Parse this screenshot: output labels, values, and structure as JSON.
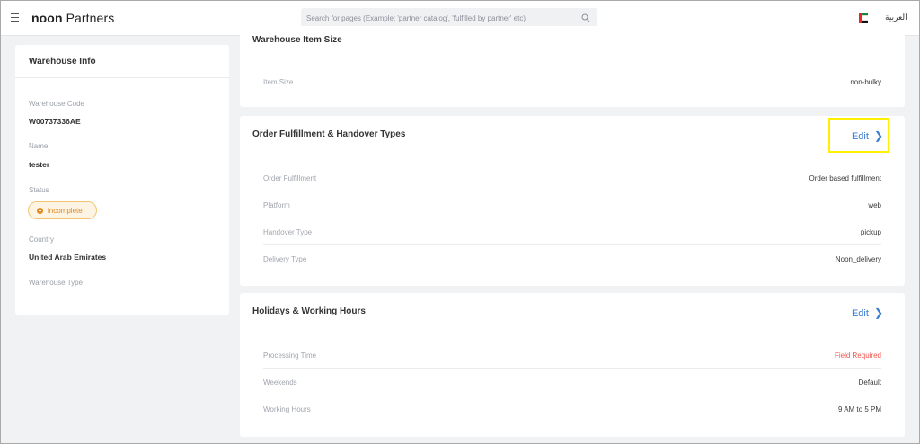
{
  "header": {
    "brand_bold": "noon",
    "brand_rest": " Partners",
    "search_placeholder": "Search for pages (Example: 'partner catalog', 'fulfilled by partner' etc)",
    "language": "العربية"
  },
  "warehouse_info": {
    "title": "Warehouse Info",
    "code_label": "Warehouse Code",
    "code_value": "W00737336AE",
    "name_label": "Name",
    "name_value": "tester",
    "status_label": "Status",
    "status_value": "incomplete",
    "country_label": "Country",
    "country_value": "United Arab Emirates",
    "type_label": "Warehouse Type"
  },
  "item_size": {
    "title": "Warehouse Item Size",
    "rows": [
      {
        "label": "Item Size",
        "value": "non-bulky"
      }
    ]
  },
  "fulfillment": {
    "title": "Order Fulfillment & Handover Types",
    "edit_label": "Edit",
    "rows": [
      {
        "label": "Order Fulfillment",
        "value": "Order based fulfillment"
      },
      {
        "label": "Platform",
        "value": "web"
      },
      {
        "label": "Handover Type",
        "value": "pickup"
      },
      {
        "label": "Delivery Type",
        "value": "Noon_delivery"
      }
    ]
  },
  "holidays": {
    "title": "Holidays & Working Hours",
    "edit_label": "Edit",
    "rows": [
      {
        "label": "Processing Time",
        "value": "Field Required"
      },
      {
        "label": "Weekends",
        "value": "Default"
      },
      {
        "label": "Working Hours",
        "value": "9 AM to 5 PM"
      }
    ]
  },
  "colors": {
    "link": "#3a7bd5",
    "required": "#f0554d",
    "status": "#e28a1c",
    "highlight": "#ffef00"
  },
  "flag": {
    "left": "#e52a2a",
    "stripes": [
      "#0f8a3a",
      "#ffffff",
      "#111111"
    ]
  }
}
